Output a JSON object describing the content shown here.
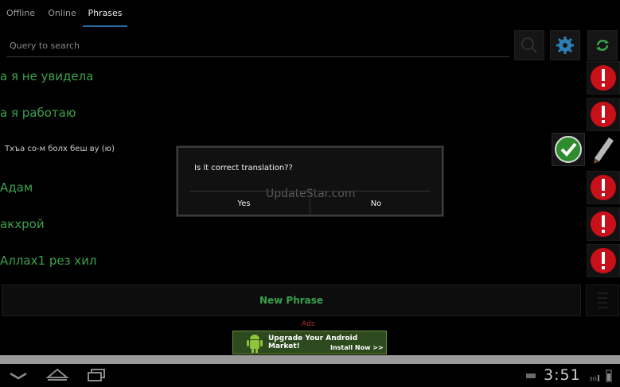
{
  "tabs": [
    {
      "label": "Offline"
    },
    {
      "label": "Online"
    },
    {
      "label": "Phrases"
    }
  ],
  "search": {
    "placeholder": "Query to search"
  },
  "toolbar": {
    "search_icon": "search-icon",
    "settings_icon": "gear-icon",
    "refresh_icon": "refresh-icon"
  },
  "phrases": [
    {
      "text": "а я не увидела"
    },
    {
      "text": "а я работаю"
    },
    {
      "text": "Тхъа со-м болх беш ву (ю)"
    },
    {
      "text": "Адам"
    },
    {
      "text": "акхрой"
    },
    {
      "text": "Аллах1 рез хил"
    }
  ],
  "new_phrase_label": "New Phrase",
  "ads": {
    "label": "Ads",
    "title": "Upgrade Your Android Market!",
    "cta": "Install Now >>"
  },
  "dialog": {
    "message": "Is it correct translation??",
    "yes": "Yes",
    "no": "No",
    "watermark": "UpdateStar.com"
  },
  "status": {
    "clock": "3:51"
  },
  "colors": {
    "accent": "#3aa14b",
    "tab_underline": "#2e6ea8",
    "alert": "#c8101a"
  }
}
